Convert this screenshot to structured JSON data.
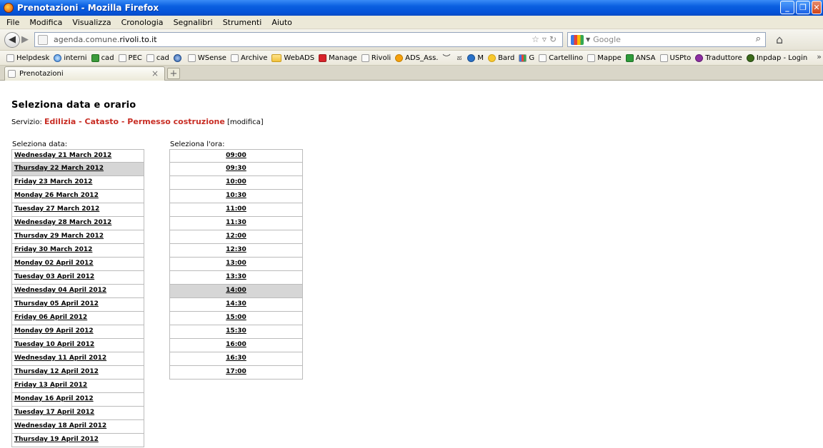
{
  "window": {
    "title": "Prenotazioni - Mozilla Firefox"
  },
  "menubar": {
    "items": [
      "File",
      "Modifica",
      "Visualizza",
      "Cronologia",
      "Segnalibri",
      "Strumenti",
      "Aiuto"
    ]
  },
  "navbar": {
    "url_prefix": "agenda.comune.",
    "url_domain": "rivoli.to.it",
    "search_placeholder": "Google"
  },
  "bookmarks": [
    {
      "label": "Helpdesk",
      "icon": "blank-page-icon"
    },
    {
      "label": "interni",
      "icon": "globe-icon"
    },
    {
      "label": "cad",
      "icon": "green-logo-icon"
    },
    {
      "label": "PEC",
      "icon": "blank-page-icon"
    },
    {
      "label": "cad",
      "icon": "blank-page-icon"
    },
    {
      "label": "",
      "icon": "gear-icon"
    },
    {
      "label": "WSense",
      "icon": "blank-page-icon"
    },
    {
      "label": "Archive",
      "icon": "blank-page-icon"
    },
    {
      "label": "WebADS",
      "icon": "folder-icon"
    },
    {
      "label": "Manage",
      "icon": "red-logo-icon"
    },
    {
      "label": "Rivoli",
      "icon": "blank-page-icon"
    },
    {
      "label": "ADS_Ass.",
      "icon": "orange-logo-icon"
    },
    {
      "label": "M",
      "icon": "blue-logo-icon"
    },
    {
      "label": "Bard",
      "icon": "sun-icon"
    },
    {
      "label": "G",
      "icon": "gplus-icon"
    },
    {
      "label": "Cartellino",
      "icon": "blank-page-icon"
    },
    {
      "label": "Mappe",
      "icon": "blank-page-icon"
    },
    {
      "label": "ANSA",
      "icon": "ansa-icon"
    },
    {
      "label": "USPto",
      "icon": "blank-page-icon"
    },
    {
      "label": "Traduttore",
      "icon": "translator-icon"
    },
    {
      "label": "Inpdap - Login",
      "icon": "inpdap-icon"
    }
  ],
  "tab": {
    "label": "Prenotazioni"
  },
  "page": {
    "heading": "Seleziona data e orario",
    "servizio_label": "Servizio: ",
    "servizio_value": "Edilizia - Catasto - Permesso costruzione",
    "modifica": " [modifica]",
    "date_header": "Seleziona data:",
    "time_header": "Seleziona l'ora:",
    "dates": [
      "Wednesday 21 March 2012",
      "Thursday 22 March 2012",
      "Friday 23 March 2012",
      "Monday 26 March 2012",
      "Tuesday 27 March 2012",
      "Wednesday 28 March 2012",
      "Thursday 29 March 2012",
      "Friday 30 March 2012",
      "Monday 02 April 2012",
      "Tuesday 03 April 2012",
      "Wednesday 04 April 2012",
      "Thursday 05 April 2012",
      "Friday 06 April 2012",
      "Monday 09 April 2012",
      "Tuesday 10 April 2012",
      "Wednesday 11 April 2012",
      "Thursday 12 April 2012",
      "Friday 13 April 2012",
      "Monday 16 April 2012",
      "Tuesday 17 April 2012",
      "Wednesday 18 April 2012",
      "Thursday 19 April 2012"
    ],
    "selected_date_index": 1,
    "times": [
      "09:00",
      "09:30",
      "10:00",
      "10:30",
      "11:00",
      "11:30",
      "12:00",
      "12:30",
      "13:00",
      "13:30",
      "14:00",
      "14:30",
      "15:00",
      "15:30",
      "16:00",
      "16:30",
      "17:00"
    ],
    "selected_time_index": 10,
    "colors": {
      "servizio": "#c82d24",
      "selected_row": "#d6d6d6"
    }
  }
}
